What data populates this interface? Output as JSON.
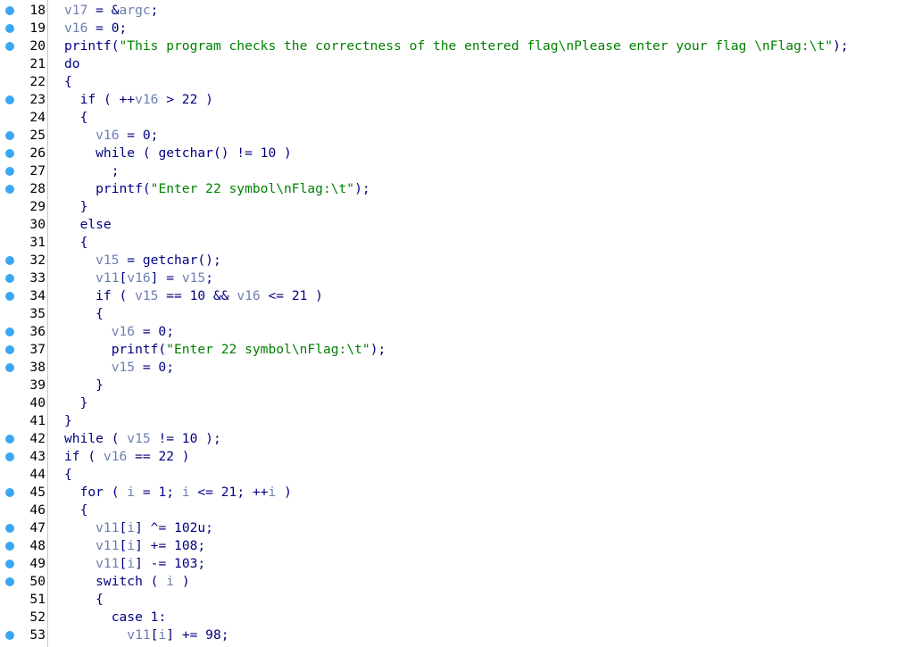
{
  "lines": [
    {
      "n": "18",
      "bp": true,
      "segs": [
        [
          "var",
          "v17"
        ],
        [
          "op",
          " = &"
        ],
        [
          "var",
          "argc"
        ],
        [
          "op",
          ";"
        ]
      ]
    },
    {
      "n": "19",
      "bp": true,
      "segs": [
        [
          "var",
          "v16"
        ],
        [
          "op",
          " = 0;"
        ]
      ]
    },
    {
      "n": "20",
      "bp": true,
      "segs": [
        [
          "kw",
          "printf("
        ],
        [
          "str",
          "\"This program checks the correctness of the entered flag\\nPlease enter your flag \\nFlag:\\t\""
        ],
        [
          "op",
          ");"
        ]
      ]
    },
    {
      "n": "21",
      "bp": false,
      "segs": [
        [
          "kw",
          "do"
        ]
      ]
    },
    {
      "n": "22",
      "bp": false,
      "segs": [
        [
          "op",
          "{"
        ]
      ]
    },
    {
      "n": "23",
      "bp": true,
      "segs": [
        [
          "kw",
          "  if"
        ],
        [
          "op",
          " ( ++"
        ],
        [
          "var",
          "v16"
        ],
        [
          "op",
          " > 22 )"
        ]
      ]
    },
    {
      "n": "24",
      "bp": false,
      "segs": [
        [
          "op",
          "  {"
        ]
      ]
    },
    {
      "n": "25",
      "bp": true,
      "segs": [
        [
          "var",
          "    v16"
        ],
        [
          "op",
          " = 0;"
        ]
      ]
    },
    {
      "n": "26",
      "bp": true,
      "segs": [
        [
          "kw",
          "    while"
        ],
        [
          "op",
          " ( "
        ],
        [
          "kw",
          "getchar"
        ],
        [
          "op",
          "() != 10 )"
        ]
      ]
    },
    {
      "n": "27",
      "bp": true,
      "segs": [
        [
          "op",
          "      ;"
        ]
      ]
    },
    {
      "n": "28",
      "bp": true,
      "segs": [
        [
          "kw",
          "    printf("
        ],
        [
          "str",
          "\"Enter 22 symbol\\nFlag:\\t\""
        ],
        [
          "op",
          ");"
        ]
      ]
    },
    {
      "n": "29",
      "bp": false,
      "segs": [
        [
          "op",
          "  }"
        ]
      ]
    },
    {
      "n": "30",
      "bp": false,
      "segs": [
        [
          "kw",
          "  else"
        ]
      ]
    },
    {
      "n": "31",
      "bp": false,
      "segs": [
        [
          "op",
          "  {"
        ]
      ]
    },
    {
      "n": "32",
      "bp": true,
      "segs": [
        [
          "var",
          "    v15"
        ],
        [
          "op",
          " = "
        ],
        [
          "kw",
          "getchar"
        ],
        [
          "op",
          "();"
        ]
      ]
    },
    {
      "n": "33",
      "bp": true,
      "segs": [
        [
          "var",
          "    v11"
        ],
        [
          "op",
          "["
        ],
        [
          "var",
          "v16"
        ],
        [
          "op",
          "] = "
        ],
        [
          "var",
          "v15"
        ],
        [
          "op",
          ";"
        ]
      ]
    },
    {
      "n": "34",
      "bp": true,
      "segs": [
        [
          "kw",
          "    if"
        ],
        [
          "op",
          " ( "
        ],
        [
          "var",
          "v15"
        ],
        [
          "op",
          " == 10 && "
        ],
        [
          "var",
          "v16"
        ],
        [
          "op",
          " <= 21 )"
        ]
      ]
    },
    {
      "n": "35",
      "bp": false,
      "segs": [
        [
          "op",
          "    {"
        ]
      ]
    },
    {
      "n": "36",
      "bp": true,
      "segs": [
        [
          "var",
          "      v16"
        ],
        [
          "op",
          " = 0;"
        ]
      ]
    },
    {
      "n": "37",
      "bp": true,
      "segs": [
        [
          "kw",
          "      printf("
        ],
        [
          "str",
          "\"Enter 22 symbol\\nFlag:\\t\""
        ],
        [
          "op",
          ");"
        ]
      ]
    },
    {
      "n": "38",
      "bp": true,
      "segs": [
        [
          "var",
          "      v15"
        ],
        [
          "op",
          " = 0;"
        ]
      ]
    },
    {
      "n": "39",
      "bp": false,
      "segs": [
        [
          "op",
          "    }"
        ]
      ]
    },
    {
      "n": "40",
      "bp": false,
      "segs": [
        [
          "op",
          "  }"
        ]
      ]
    },
    {
      "n": "41",
      "bp": false,
      "segs": [
        [
          "op",
          "}"
        ]
      ]
    },
    {
      "n": "42",
      "bp": true,
      "segs": [
        [
          "kw",
          "while"
        ],
        [
          "op",
          " ( "
        ],
        [
          "var",
          "v15"
        ],
        [
          "op",
          " != 10 );"
        ]
      ]
    },
    {
      "n": "43",
      "bp": true,
      "segs": [
        [
          "kw",
          "if"
        ],
        [
          "op",
          " ( "
        ],
        [
          "var",
          "v16"
        ],
        [
          "op",
          " == 22 )"
        ]
      ]
    },
    {
      "n": "44",
      "bp": false,
      "segs": [
        [
          "op",
          "{"
        ]
      ]
    },
    {
      "n": "45",
      "bp": true,
      "segs": [
        [
          "kw",
          "  for"
        ],
        [
          "op",
          " ( "
        ],
        [
          "var",
          "i"
        ],
        [
          "op",
          " = 1; "
        ],
        [
          "var",
          "i"
        ],
        [
          "op",
          " <= 21; ++"
        ],
        [
          "var",
          "i"
        ],
        [
          "op",
          " )"
        ]
      ]
    },
    {
      "n": "46",
      "bp": false,
      "segs": [
        [
          "op",
          "  {"
        ]
      ]
    },
    {
      "n": "47",
      "bp": true,
      "segs": [
        [
          "var",
          "    v11"
        ],
        [
          "op",
          "["
        ],
        [
          "var",
          "i"
        ],
        [
          "op",
          "] ^= 102u;"
        ]
      ]
    },
    {
      "n": "48",
      "bp": true,
      "segs": [
        [
          "var",
          "    v11"
        ],
        [
          "op",
          "["
        ],
        [
          "var",
          "i"
        ],
        [
          "op",
          "] += 108;"
        ]
      ]
    },
    {
      "n": "49",
      "bp": true,
      "segs": [
        [
          "var",
          "    v11"
        ],
        [
          "op",
          "["
        ],
        [
          "var",
          "i"
        ],
        [
          "op",
          "] -= 103;"
        ]
      ]
    },
    {
      "n": "50",
      "bp": true,
      "segs": [
        [
          "kw",
          "    switch"
        ],
        [
          "op",
          " ( "
        ],
        [
          "var",
          "i"
        ],
        [
          "op",
          " )"
        ]
      ]
    },
    {
      "n": "51",
      "bp": false,
      "segs": [
        [
          "op",
          "    {"
        ]
      ]
    },
    {
      "n": "52",
      "bp": false,
      "segs": [
        [
          "kw",
          "      case"
        ],
        [
          "op",
          " 1:"
        ]
      ]
    },
    {
      "n": "53",
      "bp": true,
      "segs": [
        [
          "var",
          "        v11"
        ],
        [
          "op",
          "["
        ],
        [
          "var",
          "i"
        ],
        [
          "op",
          "] += 98;"
        ]
      ]
    }
  ],
  "colors": {
    "keyword": "#000080",
    "variable": "#6b7fb0",
    "string": "#008000",
    "breakpoint": "#3aa7f3"
  }
}
